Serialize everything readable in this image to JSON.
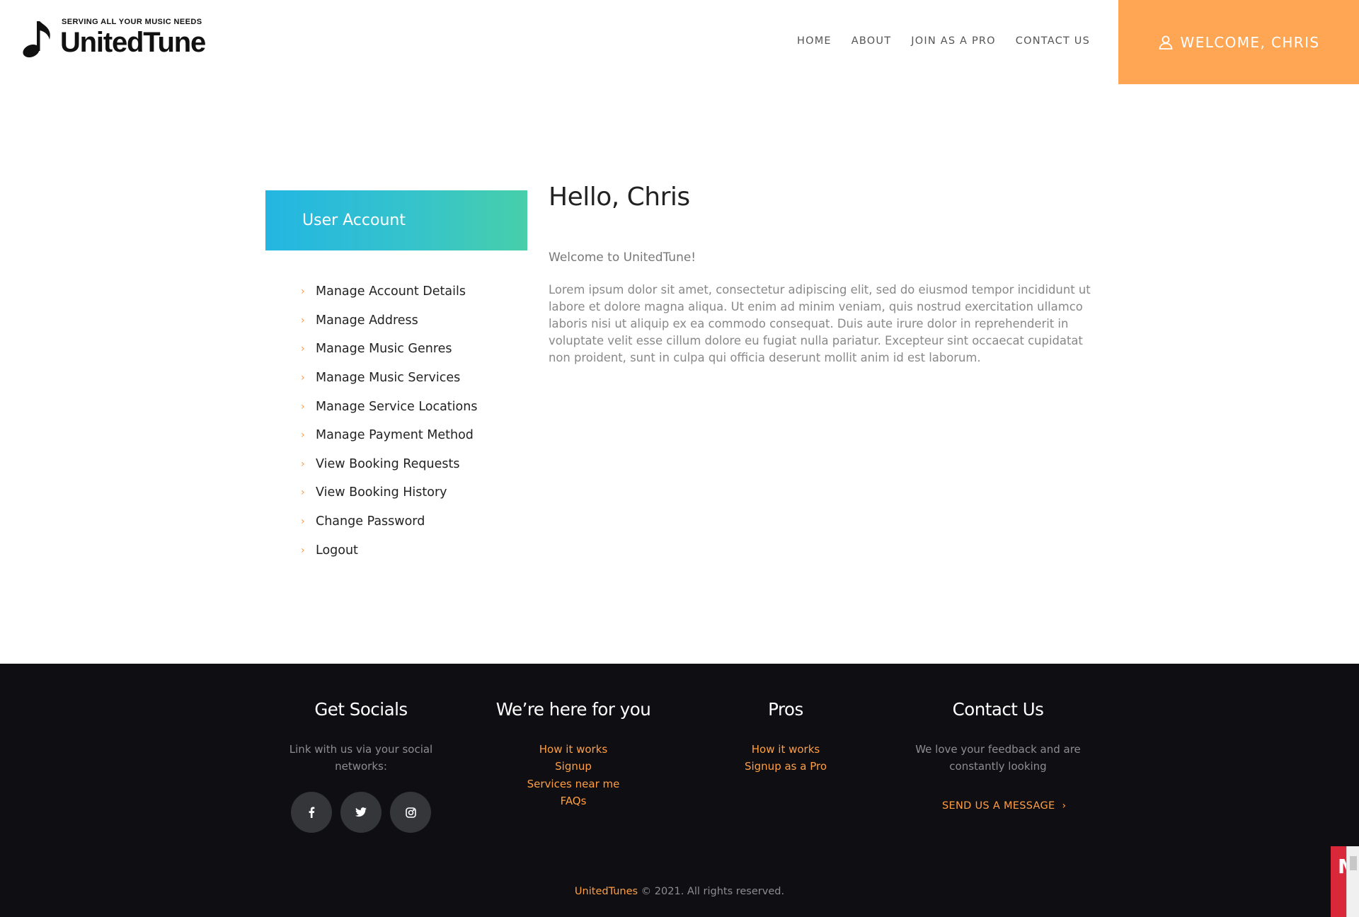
{
  "header": {
    "tagline": "SERVING ALL YOUR MUSIC NEEDS",
    "brand": "UnitedTune",
    "logo_icon": "music-note-icon",
    "nav": [
      {
        "label": "HOME"
      },
      {
        "label": "ABOUT"
      },
      {
        "label": "JOIN AS A PRO"
      },
      {
        "label": "CONTACT US"
      }
    ],
    "welcome_label": "WELCOME, CHRIS",
    "welcome_icon": "user-icon",
    "accent_color": "#ffa654"
  },
  "sidebar": {
    "title": "User Account",
    "gradient": [
      "#23b6e2",
      "#47cfaa"
    ],
    "items": [
      {
        "label": "Manage Account Details"
      },
      {
        "label": "Manage Address"
      },
      {
        "label": "Manage Music Genres"
      },
      {
        "label": "Manage Music Services"
      },
      {
        "label": "Manage Service Locations"
      },
      {
        "label": "Manage Payment Method"
      },
      {
        "label": "View Booking Requests"
      },
      {
        "label": "View Booking History"
      },
      {
        "label": "Change Password"
      },
      {
        "label": "Logout"
      }
    ]
  },
  "main": {
    "greeting": "Hello, Chris",
    "welcome_text": "Welcome to UnitedTune!",
    "body": "Lorem ipsum dolor sit amet, consectetur adipiscing elit, sed do eiusmod tempor incididunt ut labore et dolore magna aliqua. Ut enim ad minim veniam, quis nostrud exercitation ullamco laboris nisi ut aliquip ex ea commodo consequat. Duis aute irure dolor in reprehenderit in voluptate velit esse cillum dolore eu fugiat nulla pariatur. Excepteur sint occaecat cupidatat non proident, sunt in culpa qui officia deserunt mollit anim id est laborum."
  },
  "footer": {
    "socials": {
      "title": "Get Socials",
      "desc": "Link with us via your social networks:",
      "icons": [
        "facebook-icon",
        "twitter-icon",
        "instagram-icon"
      ]
    },
    "here_for_you": {
      "title": "We’re here for you",
      "links": [
        {
          "label": "How it works"
        },
        {
          "label": "Signup"
        },
        {
          "label": "Services near me"
        },
        {
          "label": "FAQs"
        }
      ]
    },
    "pros": {
      "title": "Pros",
      "links": [
        {
          "label": "How it works"
        },
        {
          "label": "Signup as a Pro"
        }
      ]
    },
    "contact": {
      "title": "Contact Us",
      "desc": "We love your feedback and are constantly looking",
      "cta": "SEND US A MESSAGE"
    },
    "copyright_brand": "UnitedTunes",
    "copyright_text": " © 2021. All rights reserved.",
    "link_color": "#ff9f43",
    "bg_color": "#0f0e13"
  },
  "widget": {
    "letter": "M"
  }
}
